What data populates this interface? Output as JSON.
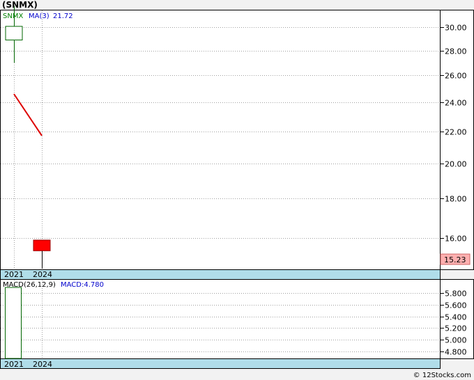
{
  "chart_data": {
    "type": "candlestick",
    "title": "(SNMX)",
    "x_labels": [
      "2021",
      "2024"
    ],
    "price_panel": {
      "ticker": "SNMX",
      "ma_label": "MA(3)",
      "ma_value": "21.72",
      "last_price": "15.23",
      "ylim": [
        14.6,
        31.5
      ],
      "yscale": "log",
      "yticks": [
        "16.00",
        "18.00",
        "20.00",
        "22.00",
        "24.00",
        "26.00",
        "28.00",
        "30.00"
      ],
      "candles": [
        {
          "x": "2021",
          "open": 28.9,
          "close": 30.1,
          "high": 32.0,
          "low": 27.0,
          "color": "#ffffff"
        },
        {
          "x": "2024",
          "open": 15.9,
          "close": 15.4,
          "high": 15.9,
          "low": 14.6,
          "color": "#ff0000"
        }
      ],
      "ma_line": [
        {
          "x": "2021",
          "y": 24.6
        },
        {
          "x": "2024",
          "y": 21.72
        }
      ],
      "ma_color": "#dd0000"
    },
    "macd_panel": {
      "label": "MACD(26,12,9)",
      "value_label": "MACD:4.780",
      "ylim": [
        4.69,
        6.02
      ],
      "yticks": [
        "4.800",
        "5.000",
        "5.200",
        "5.400",
        "5.600",
        "5.800"
      ],
      "bars": [
        {
          "x": "2021",
          "value": 5.9
        }
      ]
    },
    "watermark": "© 12Stocks.com",
    "colors": {
      "axis_band": "#b0dde9",
      "ticker": "#008000",
      "ma_label": "#0000cc",
      "last_price_box": "#ffb0b0"
    }
  }
}
